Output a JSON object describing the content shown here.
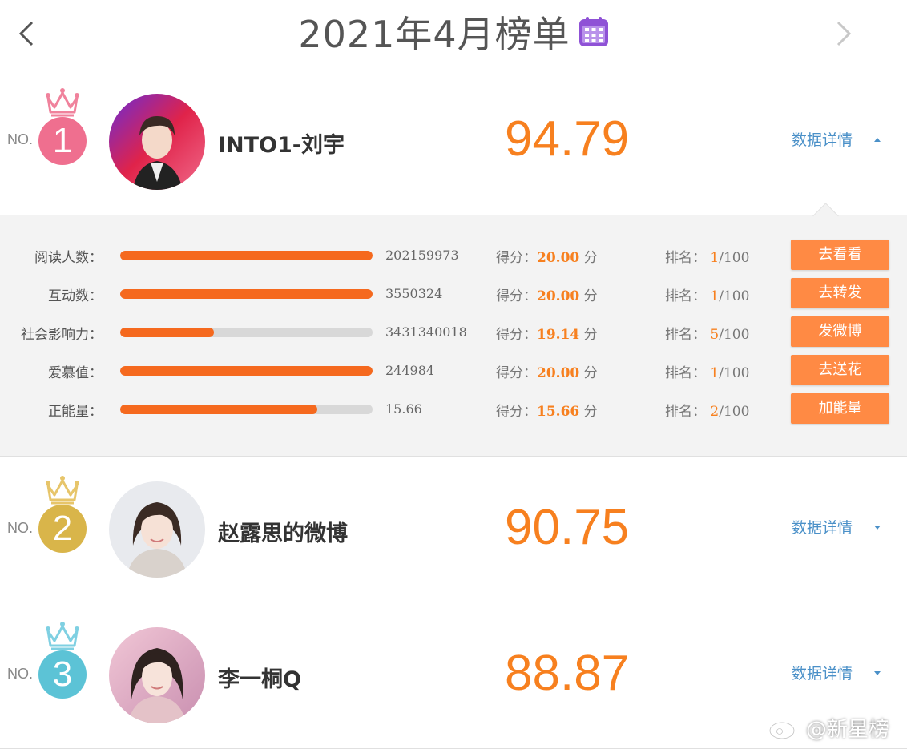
{
  "header": {
    "title": "2021年4月榜单",
    "prev_icon": "chevron-left-icon",
    "next_icon": "chevron-right-icon",
    "calendar_icon": "calendar-icon",
    "calendar_color": "#8f52d6"
  },
  "entries": [
    {
      "no_label": "NO.",
      "rank": "1",
      "name": "INTO1-刘宇",
      "score": "94.79",
      "details_label": "数据详情",
      "expanded": true,
      "crown_color": "#f0829c",
      "rank_color": "#ef6f8f"
    },
    {
      "no_label": "NO.",
      "rank": "2",
      "name": "赵露思的微博",
      "score": "90.75",
      "details_label": "数据详情",
      "expanded": false,
      "crown_color": "#e7c56a",
      "rank_color": "#d9b54a"
    },
    {
      "no_label": "NO.",
      "rank": "3",
      "name": "李一桐Q",
      "score": "88.87",
      "details_label": "数据详情",
      "expanded": false,
      "crown_color": "#7fd0e2",
      "rank_color": "#5cc3d6"
    }
  ],
  "details": {
    "score_prefix": "得分：",
    "score_unit": "分",
    "rank_prefix": "排名：",
    "rank_total": "/100",
    "metrics": [
      {
        "label": "阅读人数：",
        "value": "202159973",
        "score": "20.00",
        "rank": "1",
        "fill": 1.0,
        "button": "去看看"
      },
      {
        "label": "互动数：",
        "value": "3550324",
        "score": "20.00",
        "rank": "1",
        "fill": 1.0,
        "button": "去转发"
      },
      {
        "label": "社会影响力：",
        "value": "3431340018",
        "score": "19.14",
        "rank": "5",
        "fill": 0.37,
        "button": "发微博"
      },
      {
        "label": "爱慕值：",
        "value": "244984",
        "score": "20.00",
        "rank": "1",
        "fill": 1.0,
        "button": "去送花"
      },
      {
        "label": "正能量：",
        "value": "15.66",
        "score": "15.66",
        "rank": "2",
        "fill": 0.78,
        "button": "加能量"
      }
    ]
  },
  "watermark": {
    "text": "@新星榜",
    "icon": "weibo-logo-icon"
  },
  "colors": {
    "accent": "#f7801f",
    "button": "#ff8a44",
    "bar_fill": "#f5691e",
    "link": "#4a90c8"
  }
}
